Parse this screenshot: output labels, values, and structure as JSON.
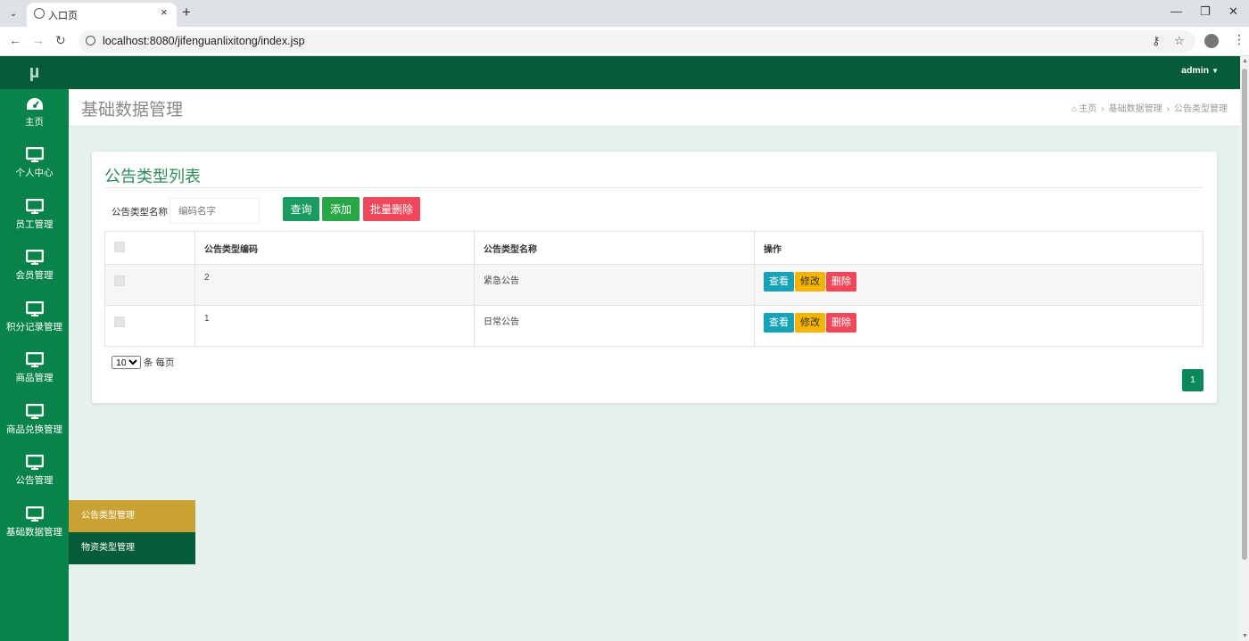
{
  "browser": {
    "tab_title": "入口页",
    "url": "localhost:8080/jifenguanlixitong/index.jsp",
    "new_tab_icon": "plus-icon",
    "close_tab": "×",
    "menu_glyph": "⌄"
  },
  "sidebar": {
    "logo": "µ",
    "items": [
      {
        "label": "主页",
        "icon": "dashboard-icon"
      },
      {
        "label": "个人中心",
        "icon": "monitor-icon"
      },
      {
        "label": "员工管理",
        "icon": "monitor-icon"
      },
      {
        "label": "会员管理",
        "icon": "monitor-icon"
      },
      {
        "label": "积分记录管理",
        "icon": "monitor-icon"
      },
      {
        "label": "商品管理",
        "icon": "monitor-icon"
      },
      {
        "label": "商品兑换管理",
        "icon": "monitor-icon"
      },
      {
        "label": "公告管理",
        "icon": "monitor-icon"
      },
      {
        "label": "基础数据管理",
        "icon": "monitor-icon"
      }
    ],
    "submenu": [
      {
        "label": "公告类型管理"
      },
      {
        "label": "物资类型管理"
      }
    ]
  },
  "topbar": {
    "user": "admin"
  },
  "pagehead": {
    "title": "基础数据管理",
    "breadcrumb": [
      "主页",
      "基础数据管理",
      "公告类型管理"
    ]
  },
  "card": {
    "title": "公告类型列表",
    "search_label": "公告类型名称",
    "search_placeholder": "编码名字",
    "buttons": {
      "query": "查询",
      "add": "添加",
      "batch_delete": "批量删除"
    },
    "table": {
      "headers": [
        "",
        "公告类型编码",
        "公告类型名称",
        "操作"
      ],
      "rows": [
        {
          "code": "2",
          "name": "紧急公告"
        },
        {
          "code": "1",
          "name": "日常公告"
        }
      ],
      "actions": {
        "view": "查看",
        "edit": "修改",
        "delete": "删除"
      }
    },
    "page_size": "10",
    "page_size_suffix": "条 每页",
    "current_page": "1"
  },
  "colors": {
    "sidebar": "#08834a",
    "topbar": "#065c38",
    "accent_title": "#2e8b57",
    "submenu_active": "#caa233"
  }
}
